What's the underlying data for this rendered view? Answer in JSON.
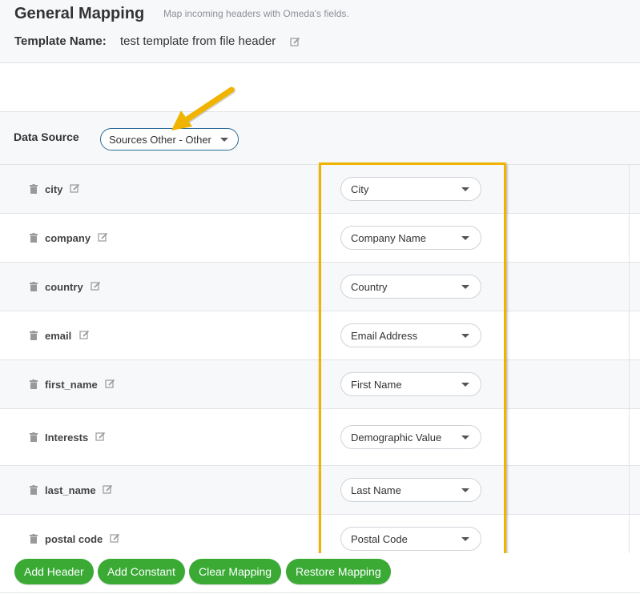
{
  "header": {
    "title": "General Mapping",
    "subtitle": "Map incoming headers with Omeda's fields.",
    "template_label": "Template Name:",
    "template_name": "test template from file header"
  },
  "data_source": {
    "label": "Data Source",
    "selected": "Sources Other - Other"
  },
  "rows": [
    {
      "field": "city",
      "mapping": "City"
    },
    {
      "field": "company",
      "mapping": "Company Name"
    },
    {
      "field": "country",
      "mapping": "Country"
    },
    {
      "field": "email",
      "mapping": "Email Address"
    },
    {
      "field": "first_name",
      "mapping": "First Name"
    },
    {
      "field": "Interests",
      "mapping": "Demographic Value"
    },
    {
      "field": "last_name",
      "mapping": "Last Name"
    },
    {
      "field": "postal code",
      "mapping": "Postal Code"
    }
  ],
  "buttons": {
    "add_header": "Add Header",
    "add_constant": "Add Constant",
    "clear_mapping": "Clear Mapping",
    "restore_mapping": "Restore Mapping"
  },
  "icons": {
    "trash": "trash-icon",
    "edit": "edit-icon",
    "dropdown": "chevron-down-icon",
    "annotation_arrow": "arrow-icon"
  },
  "colors": {
    "button_green": "#3aaa35",
    "highlight_yellow": "#f0b400",
    "select_border_blue": "#2a6c96"
  }
}
